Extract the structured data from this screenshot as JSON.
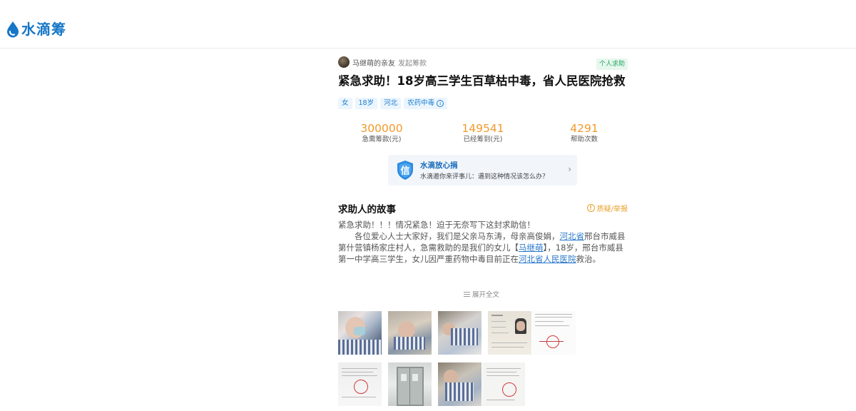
{
  "header": {
    "logo_text": "水滴筹",
    "brand_color": "#1677c8"
  },
  "campaign": {
    "initiator_name": "马继萌的亲友",
    "initiator_action": "发起筹款",
    "type_badge": "个人求助",
    "title": "紧急求助！18岁高三学生百草枯中毒，省人民医院抢救",
    "tags": [
      "女",
      "18岁",
      "河北",
      "农药中毒"
    ],
    "tag_info_icon": "info-icon"
  },
  "stats": [
    {
      "value": "300000",
      "label": "急需筹款(元)"
    },
    {
      "value": "149541",
      "label": "已经筹到(元)"
    },
    {
      "value": "4291",
      "label": "帮助次数"
    }
  ],
  "assure": {
    "badge_char": "信",
    "title": "水滴放心捐",
    "subtitle": "水滴邀你来评事儿：遇到这种情况该怎么办？",
    "arrow": "›"
  },
  "story": {
    "heading": "求助人的故事",
    "report_label": "质疑/举报",
    "report_icon_char": "!",
    "line1": "紧急求助！！！情况紧急！迫于无奈写下这封求助信！",
    "p2_a": "各位爱心人士大家好，我们是父亲马东涛，母亲高俊娟，",
    "p2_link1": "河北省",
    "p2_b": "邢台市威县第什营镇杨家庄村人，急需救助的是我们的女儿【",
    "p2_link2": "马继萌",
    "p2_c": "】，18岁，邢台市威县第一中学高三学生，女儿因严重药物中毒目前正在",
    "p2_link3": "河北省人民医院",
    "p2_d": "救治。",
    "expand_label": "展开全文"
  },
  "colors": {
    "accent_orange": "#f19a2b",
    "link_blue": "#2a78c9",
    "badge_green": "#27a765",
    "report_orange": "#e8a028"
  }
}
